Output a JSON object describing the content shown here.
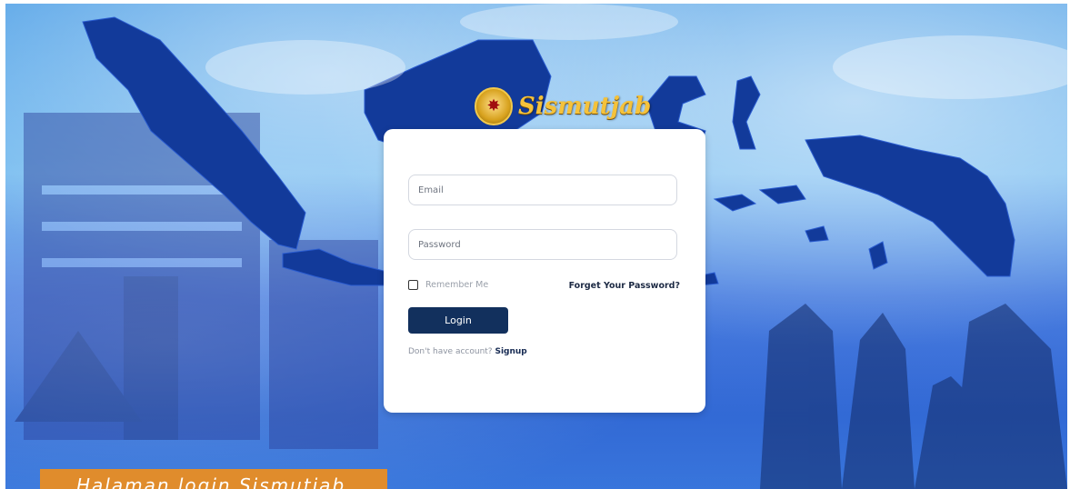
{
  "app": {
    "name": "Sismutjab",
    "emblem_icon": "police-emblem-icon"
  },
  "login_form": {
    "email_placeholder": "Email",
    "password_placeholder": "Password",
    "remember_label": "Remember Me",
    "remember_checked": false,
    "forgot_link": "Forget Your Password?",
    "login_button": "Login",
    "signup_prompt": "Don't have account?",
    "signup_link": "Signup"
  },
  "caption": {
    "text": "Halaman login Sismutjab"
  },
  "colors": {
    "button": "#12305d",
    "map": "#123a9a",
    "caption_bg": "#e08c2c",
    "logo_gold": "#f5c23b"
  }
}
